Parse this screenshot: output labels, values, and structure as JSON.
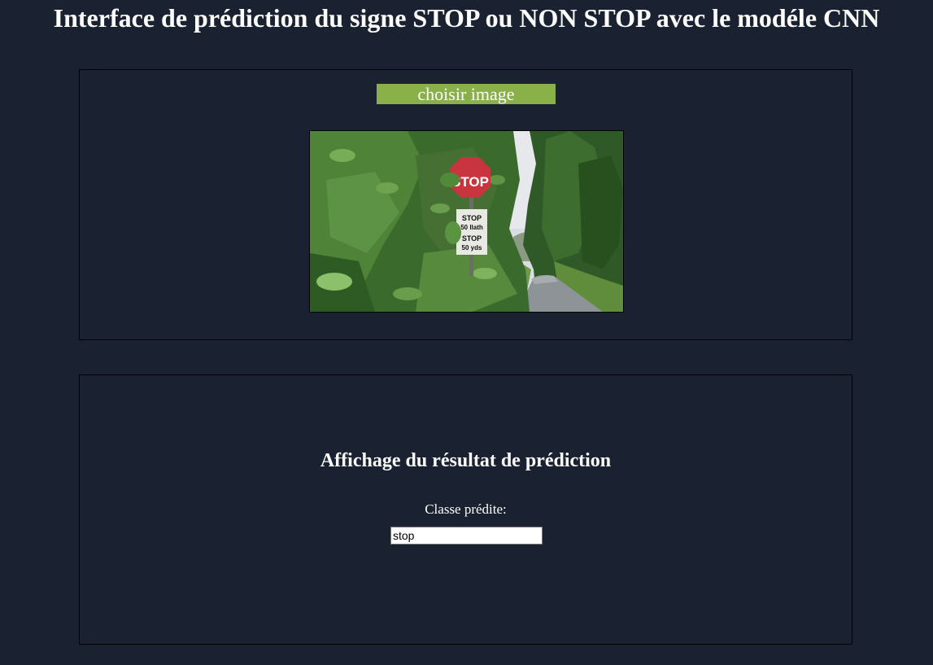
{
  "header": {
    "title": "Interface de prédiction du signe STOP ou NON STOP avec le modéle CNN"
  },
  "upload": {
    "button_label": "choisir image",
    "image": {
      "sign_top_text": "STOP",
      "plate_line1": "STOP",
      "plate_line2": "50 llath",
      "plate_line3": "STOP",
      "plate_line4": "50 yds"
    }
  },
  "result": {
    "title": "Affichage du résultat de prédiction",
    "class_label": "Classe prédite:",
    "class_value": "stop"
  },
  "colors": {
    "background": "#1a2130",
    "button": "#8ab04a",
    "text": "#ffffff"
  }
}
